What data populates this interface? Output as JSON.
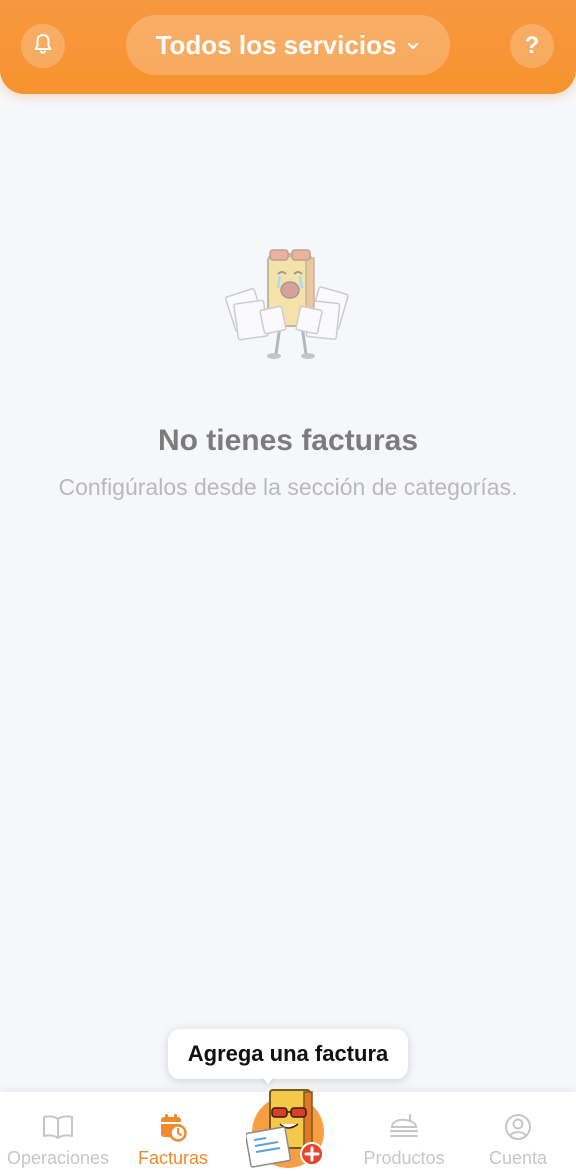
{
  "header": {
    "service_selector_label": "Todos los servicios",
    "help_label": "?",
    "accent_color": "#f7932f"
  },
  "empty_state": {
    "title": "No tienes facturas",
    "subtitle": "Configúralos desde la sección de categorías.",
    "illustration": "crying-mascot-with-invoices"
  },
  "tooltip": {
    "text": "Agrega una factura"
  },
  "bottom_nav": {
    "items": [
      {
        "label": "Operaciones",
        "icon": "book-icon",
        "active": false
      },
      {
        "label": "Facturas",
        "icon": "calendar-clock-icon",
        "active": true
      },
      {
        "label": "Productos",
        "icon": "food-tray-icon",
        "active": false
      },
      {
        "label": "Cuenta",
        "icon": "user-circle-icon",
        "active": false
      }
    ],
    "fab_icon": "mascot-add-invoice-icon",
    "active_color": "#f08a2d",
    "inactive_color": "#c6c6c6"
  }
}
